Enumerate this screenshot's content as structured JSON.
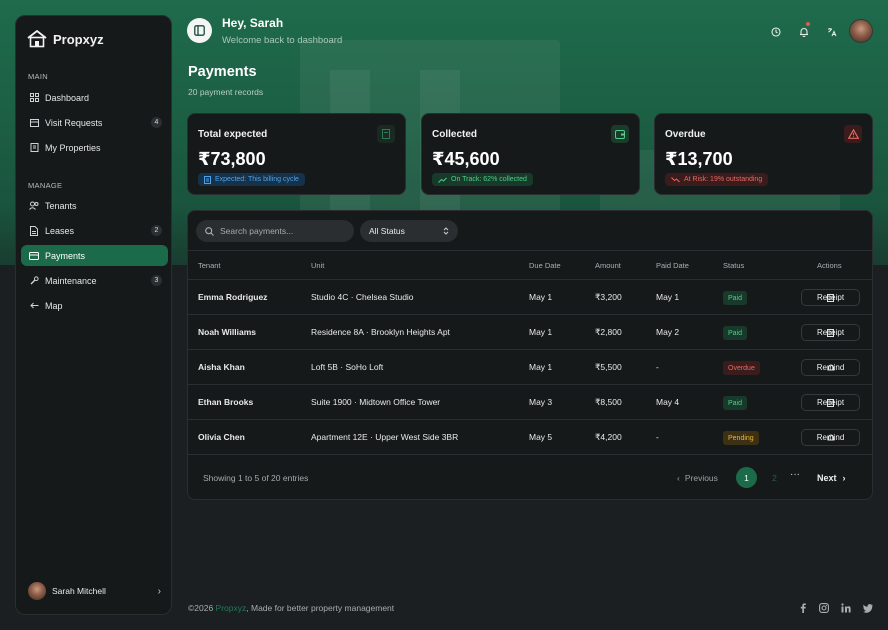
{
  "brand": {
    "name": "Propxyz"
  },
  "sidebar": {
    "section_main": "MAIN",
    "section_manage": "MANAGE",
    "items": [
      {
        "label": "Dashboard",
        "icon": "grid-icon",
        "badge": ""
      },
      {
        "label": "Visit Requests",
        "icon": "calendar-icon",
        "badge": "4"
      },
      {
        "label": "My Properties",
        "icon": "building-icon",
        "badge": ""
      },
      {
        "label": "Tenants",
        "icon": "users-icon",
        "badge": ""
      },
      {
        "label": "Leases",
        "icon": "file-icon",
        "badge": "2"
      },
      {
        "label": "Payments",
        "icon": "credit-card-icon",
        "badge": ""
      },
      {
        "label": "Maintenance",
        "icon": "wrench-icon",
        "badge": "3"
      },
      {
        "label": "Map",
        "icon": "arrow-left-icon",
        "badge": ""
      }
    ],
    "active": "Payments",
    "user": {
      "name": "Sarah Mitchell"
    }
  },
  "header": {
    "greeting": "Hey, Sarah",
    "subtitle": "Welcome back to dashboard"
  },
  "page": {
    "title": "Payments",
    "subtitle": "20 payment records"
  },
  "cards": [
    {
      "title": "Total expected",
      "value": "₹73,800",
      "pill": "Expected: This billing cycle",
      "tone": "blue",
      "color": "#4da3e8"
    },
    {
      "title": "Collected",
      "value": "₹45,600",
      "pill": "On Track: 62% collected",
      "tone": "green",
      "color": "#4fcf8a"
    },
    {
      "title": "Overdue",
      "value": "₹13,700",
      "pill": "At Risk: 19% outstanding",
      "tone": "red",
      "color": "#e46a62"
    }
  ],
  "table": {
    "search_placeholder": "Search payments...",
    "status_filter": "All Status",
    "headers": [
      "Tenant",
      "Unit",
      "Due Date",
      "Amount",
      "Paid Date",
      "Status",
      "Actions"
    ],
    "rows": [
      {
        "tenant": "Emma Rodriguez",
        "unit": "Studio 4C · Chelsea Studio",
        "due": "May 1",
        "amount": "₹3,200",
        "paid": "May 1",
        "status": "Paid",
        "action": "Receipt"
      },
      {
        "tenant": "Noah Williams",
        "unit": "Residence 8A · Brooklyn Heights Apt",
        "due": "May 1",
        "amount": "₹2,800",
        "paid": "May 2",
        "status": "Paid",
        "action": "Receipt"
      },
      {
        "tenant": "Aisha Khan",
        "unit": "Loft 5B · SoHo Loft",
        "due": "May 1",
        "amount": "₹5,500",
        "paid": "-",
        "status": "Overdue",
        "action": "Remind"
      },
      {
        "tenant": "Ethan Brooks",
        "unit": "Suite 1900 · Midtown Office Tower",
        "due": "May 3",
        "amount": "₹8,500",
        "paid": "May 4",
        "status": "Paid",
        "action": "Receipt"
      },
      {
        "tenant": "Olivia Chen",
        "unit": "Apartment 12E · Upper West Side 3BR",
        "due": "May 5",
        "amount": "₹4,200",
        "paid": "-",
        "status": "Pending",
        "action": "Remind"
      }
    ],
    "footer_info": "Showing 1 to 5 of 20 entries",
    "pagination": {
      "previous": "Previous",
      "next": "Next",
      "pages": [
        "1",
        "2"
      ],
      "current": "1",
      "ellipsis": "···"
    }
  },
  "footer": {
    "copyright_prefix": "©2026 ",
    "brand": "Propxyz",
    "suffix": ", Made for better property management",
    "socials": [
      "facebook-icon",
      "instagram-icon",
      "linkedin-icon",
      "twitter-icon"
    ]
  },
  "colors": {
    "accent": "#1b6b4a",
    "hero": "#1f6b4c",
    "background": "#1c1f21",
    "panel": "#16191a"
  }
}
